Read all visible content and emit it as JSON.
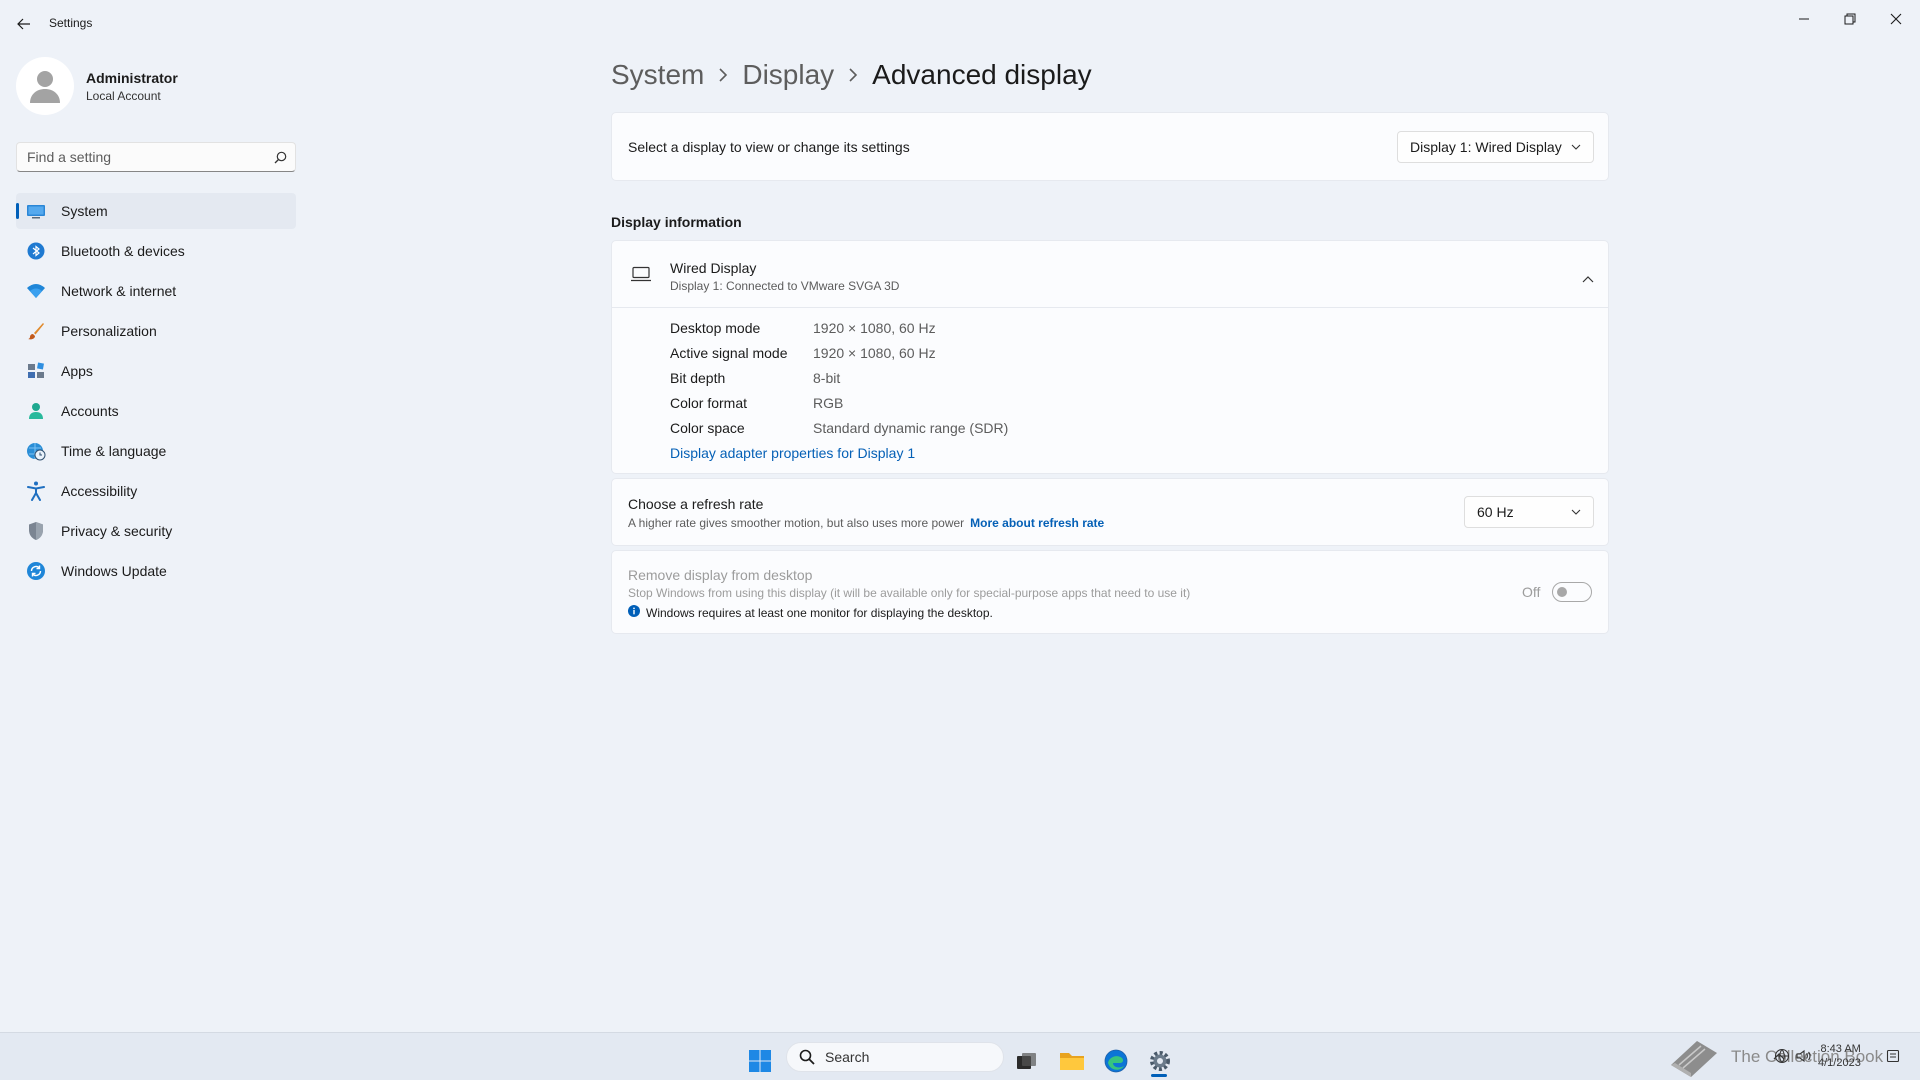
{
  "window": {
    "title": "Settings"
  },
  "profile": {
    "name": "Administrator",
    "account_type": "Local Account"
  },
  "search": {
    "placeholder": "Find a setting"
  },
  "sidebar": {
    "items": [
      {
        "label": "System",
        "icon": "monitor-icon",
        "active": true
      },
      {
        "label": "Bluetooth & devices",
        "icon": "bluetooth-icon"
      },
      {
        "label": "Network & internet",
        "icon": "wifi-icon"
      },
      {
        "label": "Personalization",
        "icon": "paintbrush-icon"
      },
      {
        "label": "Apps",
        "icon": "apps-icon"
      },
      {
        "label": "Accounts",
        "icon": "person-icon"
      },
      {
        "label": "Time & language",
        "icon": "globe-clock-icon"
      },
      {
        "label": "Accessibility",
        "icon": "accessibility-icon"
      },
      {
        "label": "Privacy & security",
        "icon": "shield-icon"
      },
      {
        "label": "Windows Update",
        "icon": "update-icon"
      }
    ]
  },
  "breadcrumb": {
    "items": [
      "System",
      "Display",
      "Advanced display"
    ]
  },
  "display_select": {
    "label": "Select a display to view or change its settings",
    "selected": "Display 1: Wired Display"
  },
  "display_information": {
    "section_title": "Display information",
    "name": "Wired Display",
    "subtitle": "Display 1: Connected to VMware SVGA 3D",
    "rows": [
      {
        "label": "Desktop mode",
        "value": "1920 × 1080, 60 Hz"
      },
      {
        "label": "Active signal mode",
        "value": "1920 × 1080, 60 Hz"
      },
      {
        "label": "Bit depth",
        "value": "8-bit"
      },
      {
        "label": "Color format",
        "value": "RGB"
      },
      {
        "label": "Color space",
        "value": "Standard dynamic range (SDR)"
      }
    ],
    "adapter_link": "Display adapter properties for Display 1"
  },
  "refresh_rate": {
    "title": "Choose a refresh rate",
    "description": "A higher rate gives smoother motion, but also uses more power",
    "link": "More about refresh rate",
    "selected": "60 Hz"
  },
  "remove_display": {
    "title": "Remove display from desktop",
    "description": "Stop Windows from using this display (it will be available only for special-purpose apps that need to use it)",
    "note": "Windows requires at least one monitor for displaying the desktop.",
    "toggle_state": "Off",
    "enabled": false
  },
  "taskbar": {
    "search_label": "Search",
    "time": "8:43 AM",
    "date": "4/1/2023",
    "watermark": "The Collection Book"
  },
  "colors": {
    "accent": "#005fb8",
    "link": "#0560b6",
    "background": "#eef2f8"
  }
}
